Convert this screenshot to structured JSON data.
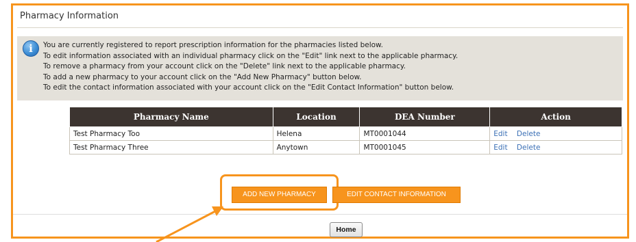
{
  "panel": {
    "title": "Pharmacy Information"
  },
  "info": {
    "icon": "info-icon",
    "icon_glyph": "i",
    "lines": [
      "You are currently registered to report prescription information for the pharmacies listed below.",
      "To edit information associated with an individual pharmacy click on the \"Edit\" link next to the applicable pharmacy.",
      "To remove a pharmacy from your account click on the \"Delete\" link next to the applicable pharmacy.",
      "To add a new pharmacy to your account click on the \"Add New Pharmacy\" button below.",
      "To edit the contact information associated with your account click on the \"Edit Contact Information\" button below."
    ]
  },
  "table": {
    "headers": [
      "Pharmacy Name",
      "Location",
      "DEA Number",
      "Action"
    ],
    "rows": [
      {
        "name": "Test Pharmacy Too",
        "location": "Helena",
        "dea": "MT0001044",
        "edit": "Edit",
        "delete": "Delete"
      },
      {
        "name": "Test Pharmacy Three",
        "location": "Anytown",
        "dea": "MT0001045",
        "edit": "Edit",
        "delete": "Delete"
      }
    ]
  },
  "buttons": {
    "add_new": "ADD NEW PHARMACY",
    "edit_contact": "EDIT CONTACT INFORMATION",
    "home": "Home"
  },
  "colors": {
    "accent_orange": "#f7941d",
    "header_dark": "#3c3430",
    "info_bg": "#e4e1da",
    "link_blue": "#3a6fb5"
  }
}
